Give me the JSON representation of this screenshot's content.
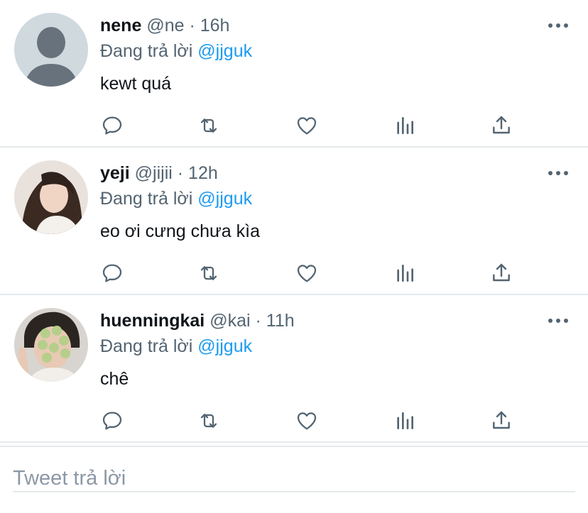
{
  "replies": [
    {
      "name": "nene",
      "handle": "@ne",
      "separator": "·",
      "time": "16h",
      "replying_prefix": "Đang trả lời",
      "replying_to": "@jjguk",
      "text": "kewt quá",
      "avatar": "default-avatar"
    },
    {
      "name": "yeji",
      "handle": "@jijii",
      "separator": "·",
      "time": "12h",
      "replying_prefix": "Đang trả lời",
      "replying_to": "@jjguk",
      "text": "eo ơi cưng chưa kìa",
      "avatar": "photo-avatar"
    },
    {
      "name": "huenningkai",
      "handle": "@kai",
      "separator": "·",
      "time": "11h",
      "replying_prefix": "Đang trả lời",
      "replying_to": "@jjguk",
      "text": "chê",
      "avatar": "photo-avatar"
    }
  ],
  "icons": {
    "reply": "reply-icon",
    "retweet": "retweet-icon",
    "like": "like-icon",
    "analytics": "analytics-icon",
    "share": "share-icon",
    "more": "more-icon"
  },
  "compose": {
    "placeholder": "Tweet trả lời"
  },
  "colors": {
    "link": "#1d9bf0",
    "secondary": "#536471",
    "divider": "#e6e9ec"
  }
}
